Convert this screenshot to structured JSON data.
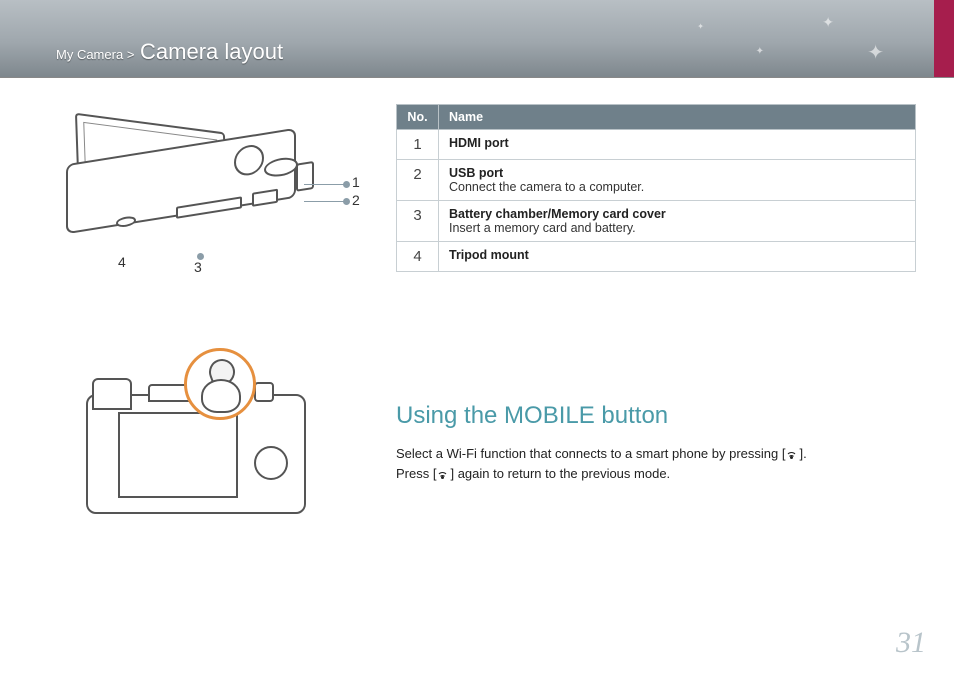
{
  "breadcrumb": {
    "section": "My Camera",
    "sep": ">",
    "page": "Camera layout"
  },
  "table": {
    "headers": {
      "no": "No.",
      "name": "Name"
    },
    "rows": [
      {
        "no": "1",
        "title": "HDMI port",
        "desc": ""
      },
      {
        "no": "2",
        "title": "USB port",
        "desc": "Connect the camera to a computer."
      },
      {
        "no": "3",
        "title": "Battery chamber/Memory card cover",
        "desc": "Insert a memory card and battery."
      },
      {
        "no": "4",
        "title": "Tripod mount",
        "desc": ""
      }
    ]
  },
  "callouts_top": {
    "c1": "1",
    "c2": "2",
    "c3": "3",
    "c4": "4"
  },
  "mobile_section": {
    "heading": "Using the MOBILE button",
    "line1_pre": "Select a Wi-Fi function that connects to a smart phone by pressing [",
    "line1_post": "].",
    "line2_pre": "Press [",
    "line2_post": "] again to return to the previous mode."
  },
  "page_number": "31"
}
